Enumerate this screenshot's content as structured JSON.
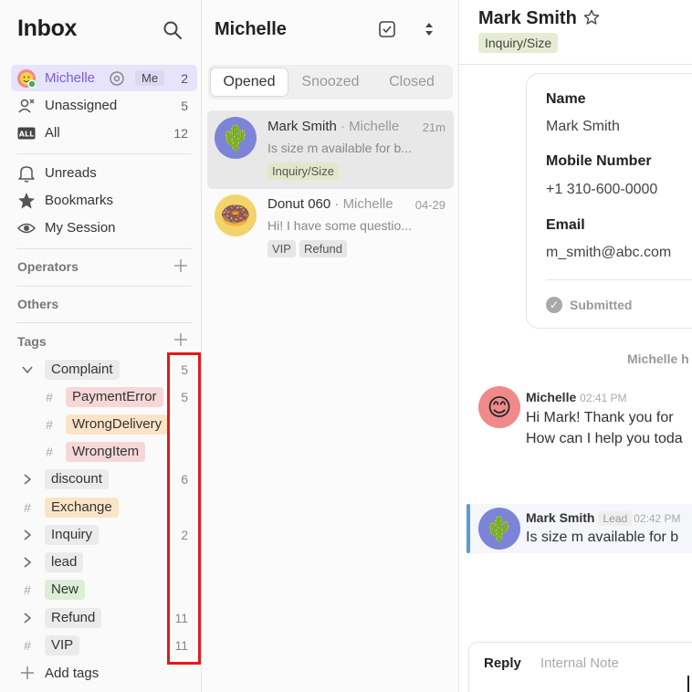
{
  "sidebar": {
    "title": "Inbox",
    "items": [
      {
        "label": "Michelle",
        "count": "2",
        "me": "Me"
      },
      {
        "label": "Unassigned",
        "count": "5"
      },
      {
        "label": "All",
        "count": "12"
      },
      {
        "label": "Unreads"
      },
      {
        "label": "Bookmarks"
      },
      {
        "label": "My Session"
      }
    ],
    "operators_label": "Operators",
    "others_label": "Others",
    "tags_label": "Tags",
    "tags": [
      {
        "name": "Complaint",
        "count": "5",
        "color": "#ebebeb"
      },
      {
        "name": "PaymentError",
        "count": "5",
        "color": "#f6d7d7"
      },
      {
        "name": "WrongDelivery",
        "count": "",
        "color": "#fbe4c6"
      },
      {
        "name": "WrongItem",
        "count": "",
        "color": "#f6d7d7"
      },
      {
        "name": "discount",
        "count": "6",
        "color": "#ebebeb"
      },
      {
        "name": "Exchange",
        "count": "",
        "color": "#fbe4c6"
      },
      {
        "name": "Inquiry",
        "count": "2",
        "color": "#ebebeb"
      },
      {
        "name": "lead",
        "count": "",
        "color": "#ebebeb"
      },
      {
        "name": "New",
        "count": "",
        "color": "#dcefd6"
      },
      {
        "name": "Refund",
        "count": "11",
        "color": "#ebebeb"
      },
      {
        "name": "VIP",
        "count": "11",
        "color": "#ebebeb"
      }
    ],
    "add_tags_label": "Add tags"
  },
  "list": {
    "title": "Michelle",
    "tabs": [
      "Opened",
      "Snoozed",
      "Closed"
    ],
    "selected_tab": "Opened",
    "conversations": [
      {
        "name": "Mark Smith",
        "operator": " · Michelle",
        "time": "21m",
        "preview": "Is size m available for b...",
        "tags": [
          "Inquiry/Size"
        ]
      },
      {
        "name": "Donut 060",
        "operator": " · Michelle",
        "time": "04-29",
        "preview": "Hi! I have some questio...",
        "tags": [
          "VIP",
          "Refund"
        ]
      }
    ]
  },
  "detail": {
    "name": "Mark Smith",
    "tag": "Inquiry/Size",
    "fields": [
      {
        "label": "Name",
        "value": "Mark Smith"
      },
      {
        "label": "Mobile Number",
        "value": "+1 310-600-0000"
      },
      {
        "label": "Email",
        "value": "m_smith@abc.com"
      }
    ],
    "submitted_label": "Submitted",
    "system_note": "Michelle h",
    "messages": [
      {
        "author": "Michelle",
        "time": "02:41 PM",
        "lines": [
          "Hi Mark! Thank you for",
          "How can I help you toda"
        ]
      },
      {
        "author": "Mark Smith",
        "badge": "Lead",
        "time": "02:42 PM",
        "lines": [
          "Is size m available for b"
        ]
      }
    ],
    "reply_tabs": [
      "Reply",
      "Internal Note"
    ]
  },
  "colors": {
    "accent": "#7a5fd0",
    "highlight_box": "#e01b1b",
    "quote_bar": "#5b9bd5"
  }
}
